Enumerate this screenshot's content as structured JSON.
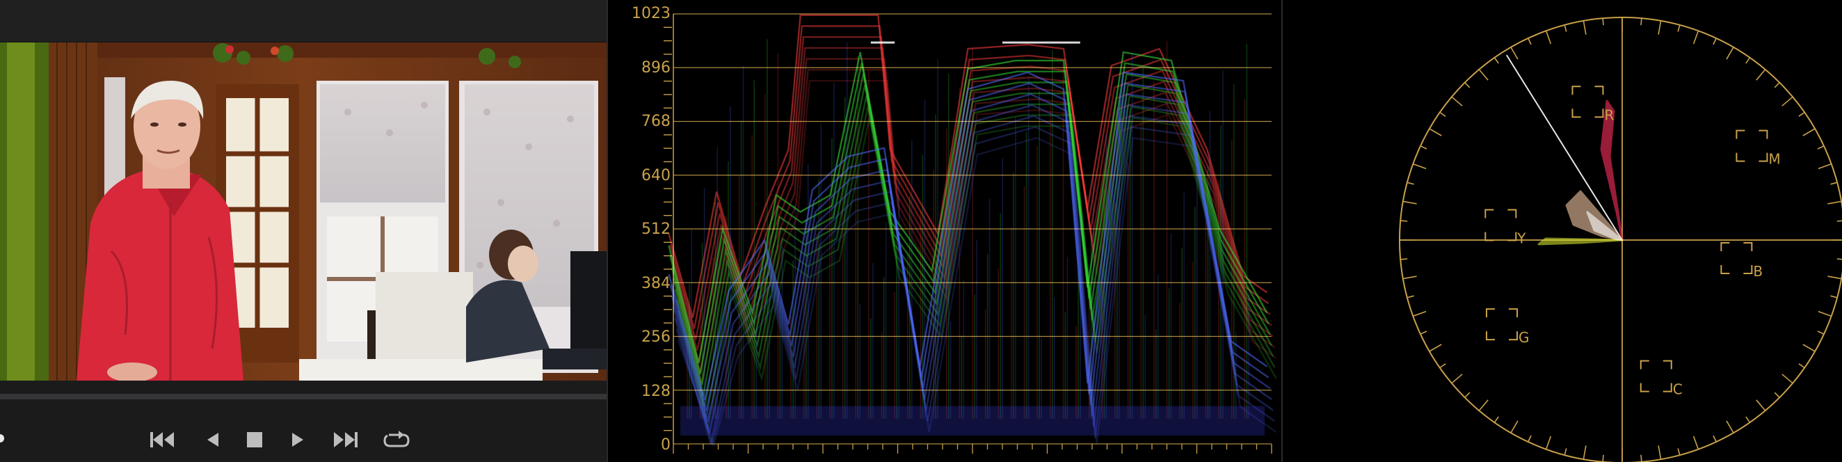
{
  "viewer": {
    "transport": {
      "skip_back": "skip-to-start",
      "step_back": "previous-frame",
      "stop": "stop",
      "play": "play",
      "skip_forward": "skip-to-end",
      "loop": "loop"
    }
  },
  "parade": {
    "axis_labels": [
      "1023",
      "896",
      "768",
      "640",
      "512",
      "384",
      "256",
      "128",
      "0"
    ],
    "grid_color": "#c9a14a"
  },
  "vectorscope": {
    "targets": [
      "M",
      "R",
      "Y",
      "B",
      "G",
      "C"
    ],
    "graticule_color": "#c9a14a"
  },
  "colors": {
    "scope_accent": "#c9a14a",
    "panel_bg": "#1b1b1c",
    "scope_bg": "#000000"
  }
}
